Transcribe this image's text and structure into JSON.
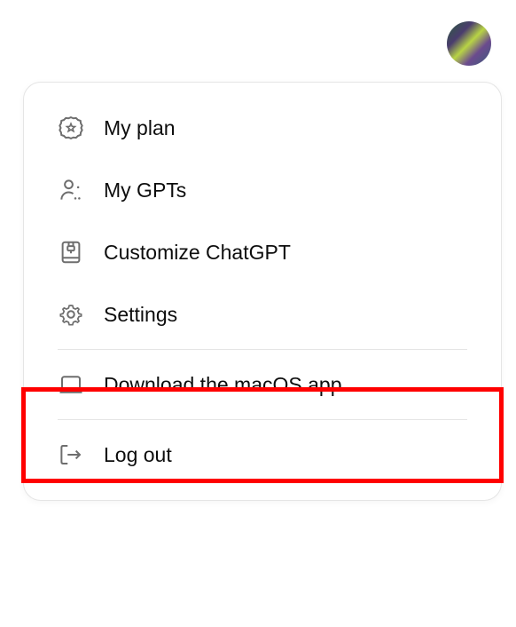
{
  "menu": {
    "items": [
      {
        "label": "My plan"
      },
      {
        "label": "My GPTs"
      },
      {
        "label": "Customize ChatGPT"
      },
      {
        "label": "Settings"
      },
      {
        "label": "Download the macOS app"
      },
      {
        "label": "Log out"
      }
    ]
  }
}
